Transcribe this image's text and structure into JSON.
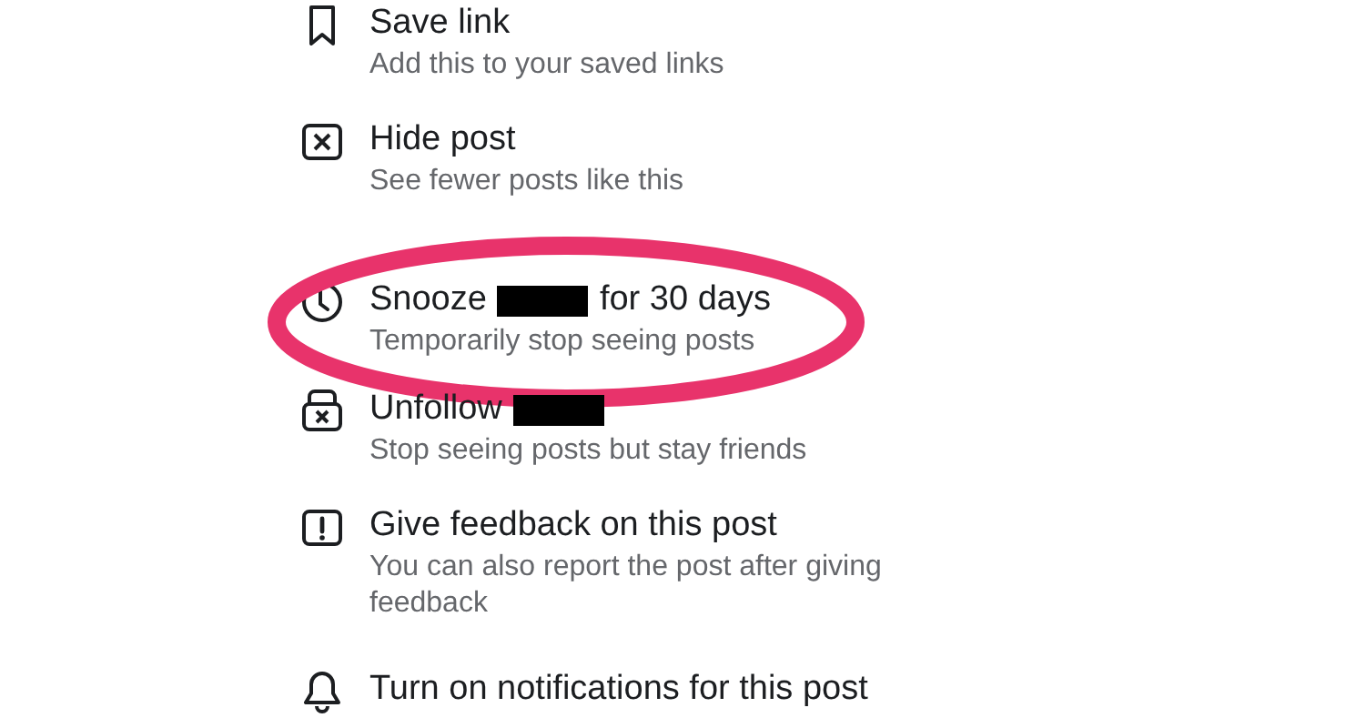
{
  "menu": {
    "items": [
      {
        "kind": "bookmark",
        "title": [
          {
            "kind": "text",
            "text": "Save link"
          }
        ],
        "subtitle": "Add this to your saved links",
        "circled": false
      },
      {
        "kind": "hide",
        "title": [
          {
            "kind": "text",
            "text": "Hide post"
          }
        ],
        "subtitle": "See fewer posts like this",
        "circled": false
      },
      {
        "kind": "clock",
        "title": [
          {
            "kind": "text",
            "text": "Snooze"
          },
          {
            "kind": "redacted"
          },
          {
            "kind": "text",
            "text": "for 30 days"
          }
        ],
        "subtitle": "Temporarily stop seeing posts",
        "circled": true
      },
      {
        "kind": "unfollow",
        "title": [
          {
            "kind": "text",
            "text": "Unfollow"
          },
          {
            "kind": "redacted"
          }
        ],
        "subtitle": "Stop seeing posts but stay friends",
        "circled": false
      },
      {
        "kind": "feedback",
        "title": [
          {
            "kind": "text",
            "text": "Give feedback on this post"
          }
        ],
        "subtitle": "You can also report the post after giving feedback",
        "circled": false
      },
      {
        "kind": "bell",
        "title": [
          {
            "kind": "text",
            "text": "Turn on notifications for this post"
          }
        ],
        "circled": false
      }
    ]
  }
}
